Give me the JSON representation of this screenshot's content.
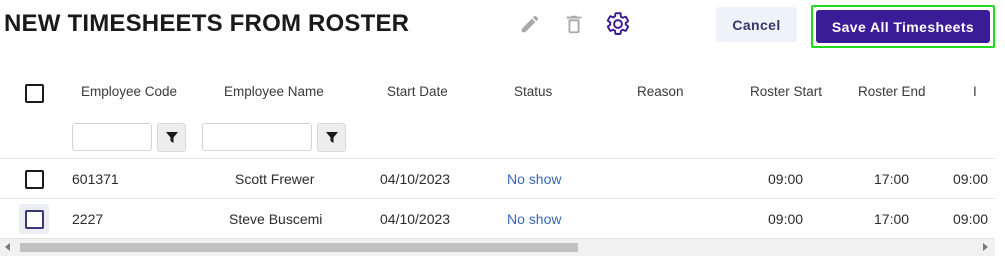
{
  "page": {
    "title": "NEW TIMESHEETS FROM ROSTER"
  },
  "toolbar": {
    "edit_icon": "pencil-icon",
    "delete_icon": "trash-icon",
    "settings_icon": "gear-icon",
    "cancel_label": "Cancel",
    "save_label": "Save All Timesheets",
    "accent_color": "#3b1c97",
    "cancel_bg": "#eef2f9"
  },
  "table": {
    "columns": [
      "Employee Code",
      "Employee Name",
      "Start Date",
      "Status",
      "Reason",
      "Roster Start",
      "Roster End",
      "I"
    ],
    "filters": {
      "employee_code": "",
      "employee_name": ""
    },
    "rows": [
      {
        "employee_code": "601371",
        "employee_name": "Scott Frewer",
        "start_date": "04/10/2023",
        "status": "No show",
        "reason": "",
        "roster_start": "09:00",
        "roster_end": "17:00",
        "extra": "09:00"
      },
      {
        "employee_code": "2227",
        "employee_name": "Steve Buscemi",
        "start_date": "04/10/2023",
        "status": "No show",
        "reason": "",
        "roster_start": "09:00",
        "roster_end": "17:00",
        "extra": "09:00"
      }
    ],
    "status_color": "#3a66b8"
  }
}
